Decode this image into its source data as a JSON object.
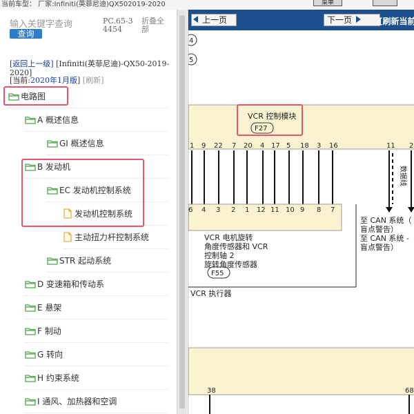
{
  "top_strip": {
    "vehicle_text": "当前车型：  厂家:Infiniti(英菲尼迪)QX502019-2020",
    "btn_label": "菜单"
  },
  "search": {
    "placeholder": "输入关键字查询",
    "button_label": "查询",
    "pc_code": "PC.65-34454",
    "collapse_all": "折叠全部"
  },
  "nav": {
    "back_label": "[返回上一级]",
    "model_text": "[Infiniti(英菲尼迪)-QX50-2019-2020]",
    "current_label": "[当前:",
    "current_value": "2020年1月版",
    "current_close": "]",
    "refresh_label": "[刷新]"
  },
  "tree": [
    {
      "label": "电路图",
      "type": "folder",
      "level": 0
    },
    {
      "label": "A 概述信息",
      "type": "folder",
      "level": 1
    },
    {
      "label": "GI 概述信息",
      "type": "folder",
      "level": 2
    },
    {
      "label": "B 发动机",
      "type": "folder",
      "level": 1
    },
    {
      "label": "EC 发动机控制系统",
      "type": "folder",
      "level": 2
    },
    {
      "label": "发动机控制系统",
      "type": "doc",
      "level": 3
    },
    {
      "label": "主动扭力杆控制系统",
      "type": "doc",
      "level": 3
    },
    {
      "label": "STR 起动系统",
      "type": "folder",
      "level": 2
    },
    {
      "label": "D 变速箱和传动系",
      "type": "folder",
      "level": 1
    },
    {
      "label": "E 悬架",
      "type": "folder",
      "level": 1
    },
    {
      "label": "F 制动",
      "type": "folder",
      "level": 1
    },
    {
      "label": "G 转向",
      "type": "folder",
      "level": 1
    },
    {
      "label": "H 约束系统",
      "type": "folder",
      "level": 1
    },
    {
      "label": "I 通风、加热器和空调",
      "type": "folder",
      "level": 1
    }
  ],
  "toolbar": {
    "prev_label": "上一页",
    "next_label": "下一页",
    "refresh_label": "[刷新当前"
  },
  "diagram": {
    "side_circles": [
      "4",
      "5"
    ],
    "module_title": "VCR 控制模块",
    "module_connector": "F27",
    "top_pins": [
      "1",
      "9",
      "22",
      "7",
      "20",
      "4",
      "17",
      "5",
      "18",
      "3",
      "16"
    ],
    "right_pins_top": [
      "11",
      "2"
    ],
    "bottom_pins": [
      "6",
      "4",
      "3",
      "2",
      "1",
      "12",
      "11",
      "10",
      "9",
      "8",
      "7"
    ],
    "vertical_label": "数据线",
    "sensor_lines": [
      "VCR 电机旋转",
      "角度传感器和 VCR",
      "控制轴 2",
      "旋转角度传感器"
    ],
    "sensor_connector": "F55",
    "actuator_label": "VCR 执行器",
    "can_line1": "至 CAN 系统（",
    "can_line1b": "盲点警告）",
    "can_line2": "至 CAN 系统 -",
    "can_line2b": "盲点警告）",
    "lower_pin_left": "38",
    "lower_pin_right": "68"
  },
  "colors": {
    "toolbar_bg": "#1b4f8e",
    "highlight": "#e5556e",
    "link": "#1a3aa0",
    "module_fill": "#fbf3d0",
    "search_btn": "#2f7cc9"
  }
}
